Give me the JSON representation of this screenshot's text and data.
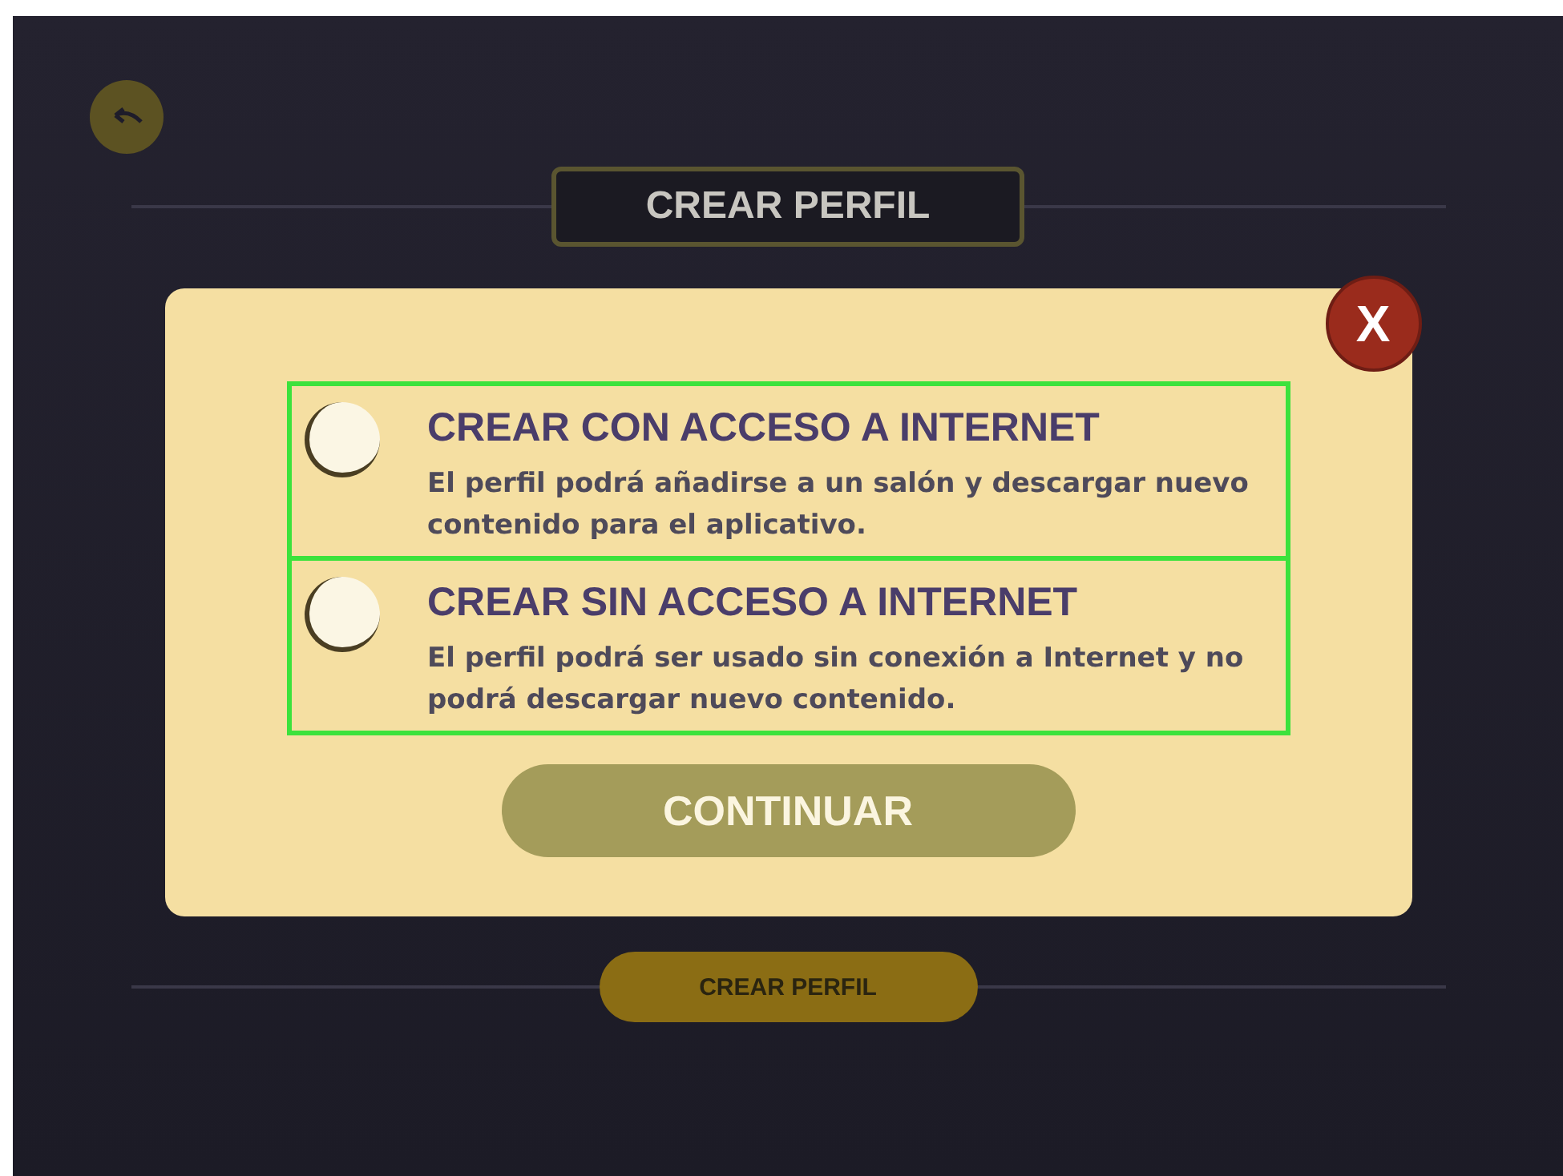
{
  "header": {
    "title": "CREAR PERFIL"
  },
  "dialog": {
    "close": "X",
    "options": [
      {
        "title": "CREAR CON ACCESO A INTERNET",
        "description": "El perfil podrá añadirse a un salón y descargar nuevo contenido para el aplicativo.",
        "selected": false
      },
      {
        "title": "CREAR SIN ACCESO A INTERNET",
        "description": "El perfil podrá ser usado sin conexión a Internet y no podrá descargar nuevo contenido.",
        "selected": false
      }
    ],
    "button": "CONTINUAR"
  },
  "footer_button": "CREAR PERFIL"
}
